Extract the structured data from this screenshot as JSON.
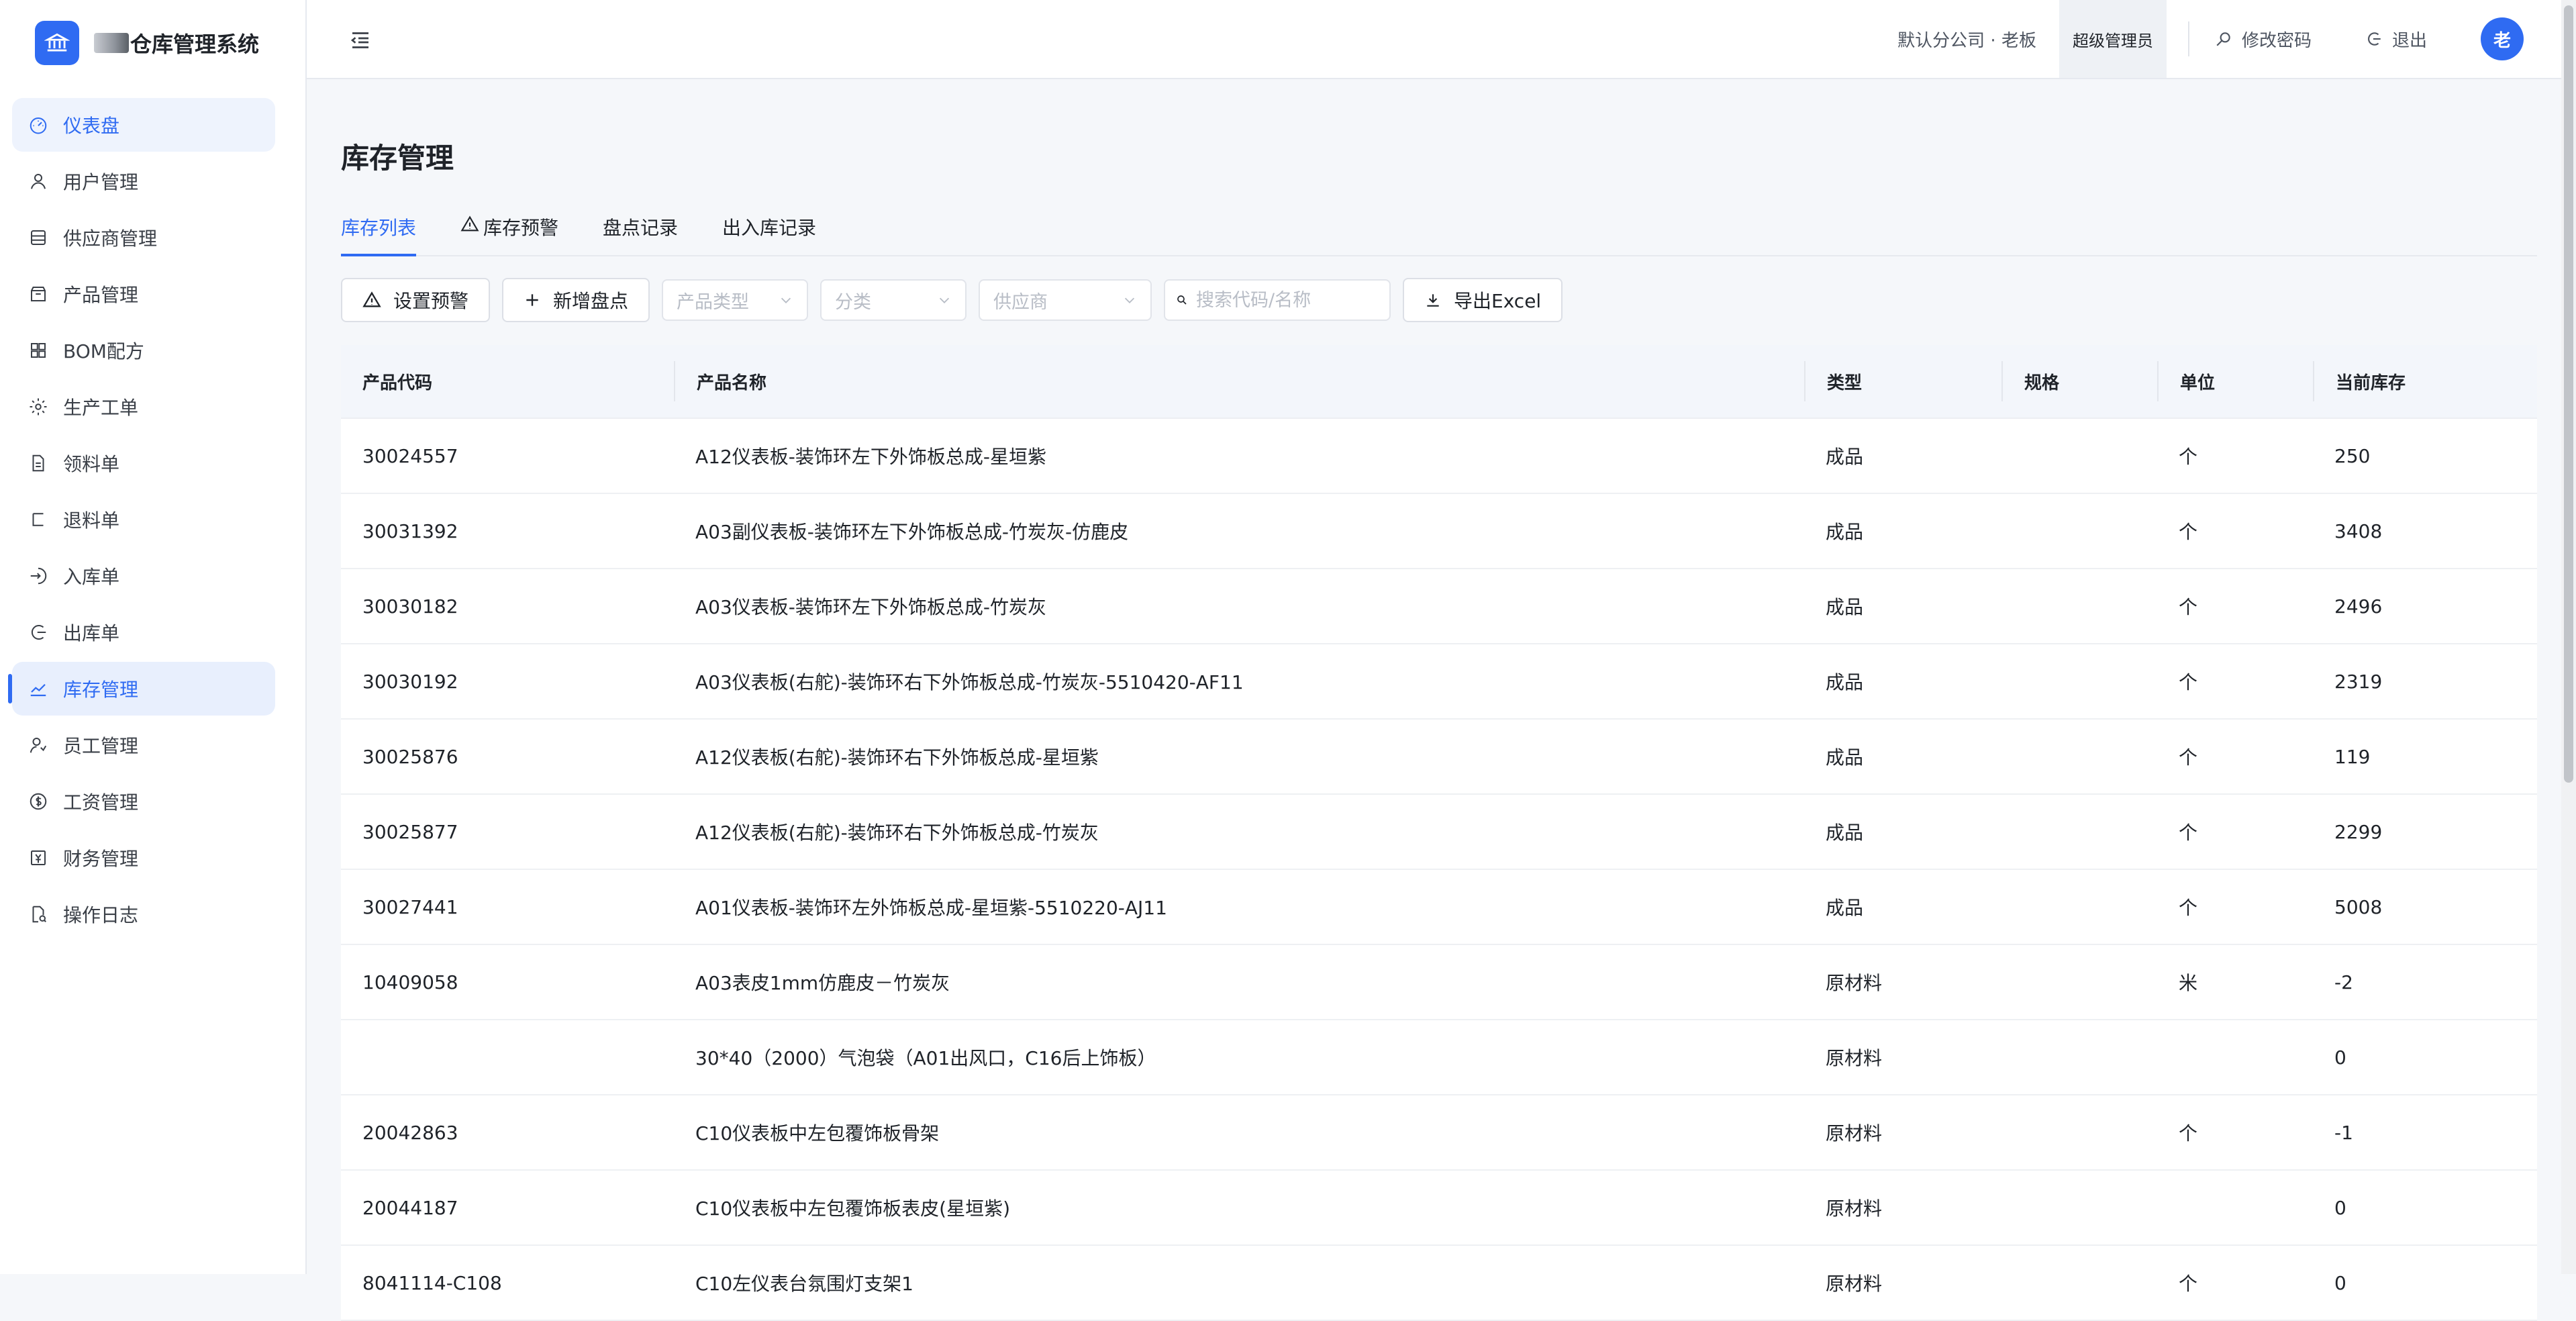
{
  "app": {
    "title": "仓库管理系统"
  },
  "sidebar": {
    "items": [
      {
        "label": "仪表盘",
        "icon": "dashboard-icon"
      },
      {
        "label": "用户管理",
        "icon": "user-icon"
      },
      {
        "label": "供应商管理",
        "icon": "store-icon"
      },
      {
        "label": "产品管理",
        "icon": "box-icon"
      },
      {
        "label": "BOM配方",
        "icon": "grid-icon"
      },
      {
        "label": "生产工单",
        "icon": "gear-icon"
      },
      {
        "label": "领料单",
        "icon": "document-icon"
      },
      {
        "label": "退料单",
        "icon": "return-icon"
      },
      {
        "label": "入库单",
        "icon": "login-icon"
      },
      {
        "label": "出库单",
        "icon": "logout-icon"
      },
      {
        "label": "库存管理",
        "icon": "chart-line-icon"
      },
      {
        "label": "员工管理",
        "icon": "employee-icon"
      },
      {
        "label": "工资管理",
        "icon": "dollar-icon"
      },
      {
        "label": "财务管理",
        "icon": "finance-icon"
      },
      {
        "label": "操作日志",
        "icon": "log-icon"
      }
    ]
  },
  "header": {
    "org": "默认分公司 · 老板",
    "role": "超级管理员",
    "change_password": "修改密码",
    "logout": "退出",
    "avatar": "老"
  },
  "page": {
    "title": "库存管理",
    "tabs": [
      {
        "label": "库存列表"
      },
      {
        "label": "库存预警"
      },
      {
        "label": "盘点记录"
      },
      {
        "label": "出入库记录"
      }
    ]
  },
  "toolbar": {
    "set_alert": "设置预警",
    "new_count": "新增盘点",
    "product_type_placeholder": "产品类型",
    "category_placeholder": "分类",
    "supplier_placeholder": "供应商",
    "search_placeholder": "搜索代码/名称",
    "export": "导出Excel"
  },
  "table": {
    "columns": [
      "产品代码",
      "产品名称",
      "类型",
      "规格",
      "单位",
      "当前库存"
    ],
    "rows": [
      {
        "code": "30024557",
        "name": "A12仪表板-装饰环左下外饰板总成-星垣紫",
        "type": "成品",
        "spec": "",
        "unit": "个",
        "stock": "250"
      },
      {
        "code": "30031392",
        "name": "A03副仪表板-装饰环左下外饰板总成-竹炭灰-仿鹿皮",
        "type": "成品",
        "spec": "",
        "unit": "个",
        "stock": "3408"
      },
      {
        "code": "30030182",
        "name": "A03仪表板-装饰环左下外饰板总成-竹炭灰",
        "type": "成品",
        "spec": "",
        "unit": "个",
        "stock": "2496"
      },
      {
        "code": "30030192",
        "name": "A03仪表板(右舵)-装饰环右下外饰板总成-竹炭灰-5510420-AF11",
        "type": "成品",
        "spec": "",
        "unit": "个",
        "stock": "2319"
      },
      {
        "code": "30025876",
        "name": "A12仪表板(右舵)-装饰环右下外饰板总成-星垣紫",
        "type": "成品",
        "spec": "",
        "unit": "个",
        "stock": "119"
      },
      {
        "code": "30025877",
        "name": "A12仪表板(右舵)-装饰环右下外饰板总成-竹炭灰",
        "type": "成品",
        "spec": "",
        "unit": "个",
        "stock": "2299"
      },
      {
        "code": "30027441",
        "name": "A01仪表板-装饰环左外饰板总成-星垣紫-5510220-AJ11",
        "type": "成品",
        "spec": "",
        "unit": "个",
        "stock": "5008"
      },
      {
        "code": "10409058",
        "name": "A03表皮1mm仿鹿皮－竹炭灰",
        "type": "原材料",
        "spec": "",
        "unit": "米",
        "stock": "-2"
      },
      {
        "code": "",
        "name": "30*40（2000）气泡袋（A01出风口，C16后上饰板）",
        "type": "原材料",
        "spec": "",
        "unit": "",
        "stock": "0"
      },
      {
        "code": "20042863",
        "name": "C10仪表板中左包覆饰板骨架",
        "type": "原材料",
        "spec": "",
        "unit": "个",
        "stock": "-1"
      },
      {
        "code": "20044187",
        "name": "C10仪表板中左包覆饰板表皮(星垣紫)",
        "type": "原材料",
        "spec": "",
        "unit": "",
        "stock": "0"
      },
      {
        "code": "8041114-C108",
        "name": "C10左仪表台氛围灯支架1",
        "type": "原材料",
        "spec": "",
        "unit": "个",
        "stock": "0"
      }
    ]
  }
}
